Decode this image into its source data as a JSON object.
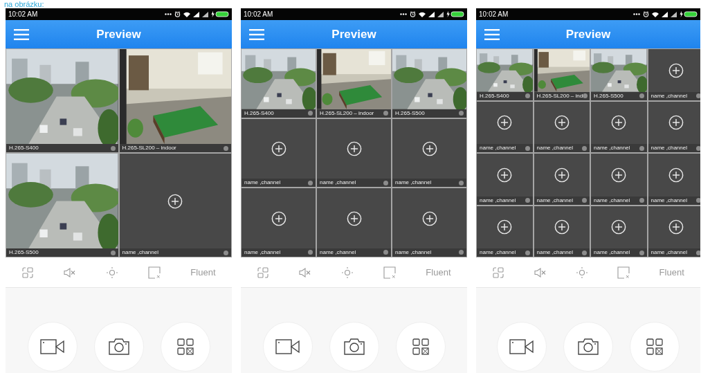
{
  "caption": "na obrázku:",
  "phones": [
    {
      "status_time": "10:02 AM",
      "title": "Preview",
      "cells": [
        {
          "kind": "camera",
          "label": "H.265-S400"
        },
        {
          "kind": "camera",
          "label": "H.265-SL200 – indoor"
        },
        {
          "kind": "camera",
          "label": "H.265-S500"
        },
        {
          "kind": "empty",
          "label": "name ,channel"
        }
      ],
      "toolbar": [
        {
          "kind": "split"
        },
        {
          "kind": "mute"
        },
        {
          "kind": "brightness"
        },
        {
          "kind": "close-window"
        },
        {
          "kind": "text",
          "label": "Fluent"
        }
      ],
      "actions": [
        {
          "kind": "record"
        },
        {
          "kind": "snapshot"
        },
        {
          "kind": "multiview"
        }
      ]
    },
    {
      "status_time": "10:02 AM",
      "title": "Preview",
      "cells": [
        {
          "kind": "camera",
          "label": "H.265-S400"
        },
        {
          "kind": "camera",
          "label": "H.265-SL200 – indoor"
        },
        {
          "kind": "camera",
          "label": "H.265-S500"
        },
        {
          "kind": "empty",
          "label": "name ,channel"
        },
        {
          "kind": "empty",
          "label": "name ,channel"
        },
        {
          "kind": "empty",
          "label": "name ,channel"
        },
        {
          "kind": "empty",
          "label": "name ,channel"
        },
        {
          "kind": "empty",
          "label": "name ,channel"
        },
        {
          "kind": "empty",
          "label": "name ,channel"
        }
      ],
      "toolbar": [
        {
          "kind": "split"
        },
        {
          "kind": "mute"
        },
        {
          "kind": "brightness"
        },
        {
          "kind": "close-window"
        },
        {
          "kind": "text",
          "label": "Fluent"
        }
      ],
      "actions": [
        {
          "kind": "record"
        },
        {
          "kind": "snapshot"
        },
        {
          "kind": "multiview"
        }
      ]
    },
    {
      "status_time": "10:02 AM",
      "title": "Preview",
      "cells": [
        {
          "kind": "camera",
          "label": "H.265-S400"
        },
        {
          "kind": "camera",
          "label": "H.265-SL200 – ind"
        },
        {
          "kind": "camera",
          "label": "H.265-S500"
        },
        {
          "kind": "empty",
          "label": "name ,channel"
        },
        {
          "kind": "empty",
          "label": "name ,channel"
        },
        {
          "kind": "empty",
          "label": "name ,channel"
        },
        {
          "kind": "empty",
          "label": "name ,channel"
        },
        {
          "kind": "empty",
          "label": "name ,channel"
        },
        {
          "kind": "empty",
          "label": "name ,channel"
        },
        {
          "kind": "empty",
          "label": "name ,channel"
        },
        {
          "kind": "empty",
          "label": "name ,channel"
        },
        {
          "kind": "empty",
          "label": "name ,channel"
        },
        {
          "kind": "empty",
          "label": "name ,channel"
        },
        {
          "kind": "empty",
          "label": "name ,channel"
        },
        {
          "kind": "empty",
          "label": "name ,channel"
        },
        {
          "kind": "empty",
          "label": "name ,channel"
        }
      ],
      "toolbar": [
        {
          "kind": "split"
        },
        {
          "kind": "mute"
        },
        {
          "kind": "brightness"
        },
        {
          "kind": "close-window"
        },
        {
          "kind": "text",
          "label": "Fluent"
        }
      ],
      "actions": [
        {
          "kind": "record"
        },
        {
          "kind": "snapshot"
        },
        {
          "kind": "multiview"
        }
      ]
    }
  ]
}
